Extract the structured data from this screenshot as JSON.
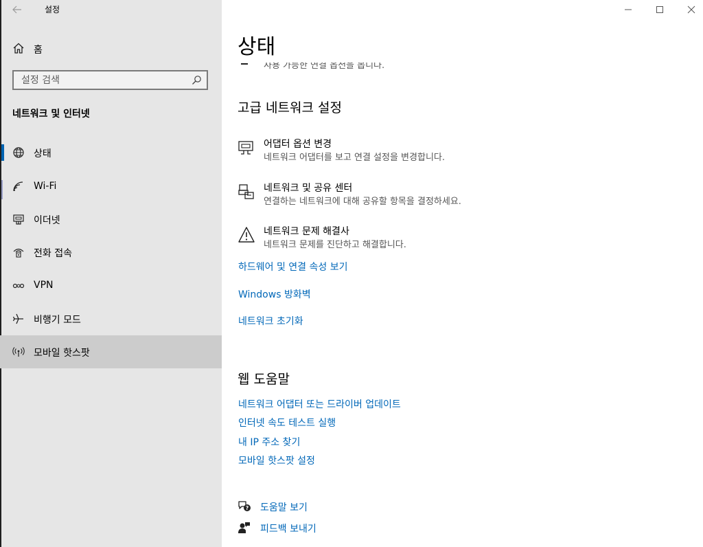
{
  "window": {
    "title": "설정"
  },
  "sidebar": {
    "home_label": "홈",
    "search_placeholder": "설정 검색",
    "section_title": "네트워크 및 인터넷",
    "items": [
      {
        "label": "상태",
        "icon": "globe-icon"
      },
      {
        "label": "Wi-Fi",
        "icon": "wifi-icon"
      },
      {
        "label": "이더넷",
        "icon": "ethernet-icon"
      },
      {
        "label": "전화 접속",
        "icon": "dialup-icon"
      },
      {
        "label": "VPN",
        "icon": "vpn-icon"
      },
      {
        "label": "비행기 모드",
        "icon": "airplane-icon"
      },
      {
        "label": "모바일 핫스팟",
        "icon": "hotspot-icon"
      }
    ],
    "selected_item": "모바일 핫스팟",
    "accent_color": "#0063b1"
  },
  "main": {
    "title": "상태",
    "partial_text": "사용 가능한 연결 옵션을 봅니다.",
    "advanced": {
      "heading": "고급 네트워크 설정",
      "options": [
        {
          "title": "어댑터 옵션 변경",
          "desc": "네트워크 어댑터를 보고 연결 설정을 변경합니다.",
          "icon": "network-adapter-icon"
        },
        {
          "title": "네트워크 및 공유 센터",
          "desc": "연결하는 네트워크에 대해 공유할 항목을 결정하세요.",
          "icon": "sharing-center-icon"
        },
        {
          "title": "네트워크 문제 해결사",
          "desc": "네트워크 문제를 진단하고 해결합니다.",
          "icon": "warning-icon"
        }
      ],
      "links": [
        "하드웨어 및 연결 속성 보기",
        "Windows 방화벽",
        "네트워크 초기화"
      ]
    },
    "web_help": {
      "heading": "웹 도움말",
      "links": [
        "네트워크 어댑터 또는 드라이버 업데이트",
        "인터넷 속도 테스트 실행",
        "내 IP 주소 찾기",
        "모바일 핫스팟 설정"
      ]
    },
    "footer": {
      "help_label": "도움말 보기",
      "feedback_label": "피드백 보내기"
    },
    "link_color": "#0067b8"
  }
}
